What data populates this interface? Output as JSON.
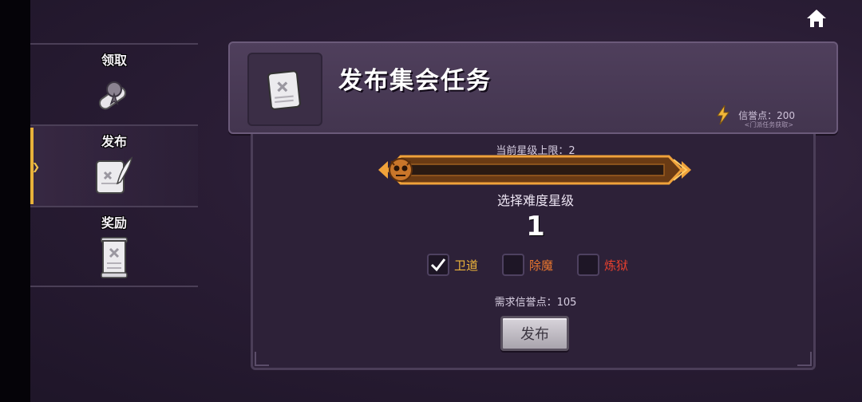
{
  "sidebar": {
    "items": [
      {
        "label": "领取",
        "icon": "scroll-sealed-icon",
        "active": false
      },
      {
        "label": "发布",
        "icon": "scroll-quill-icon",
        "active": true
      },
      {
        "label": "奖励",
        "icon": "scroll-open-icon",
        "active": false
      }
    ]
  },
  "header": {
    "title": "发布集会任务",
    "honor_label": "信誉点：200",
    "honor_sub": "<门派任务获取>"
  },
  "main": {
    "level_cap_text": "当前星级上限：2",
    "difficulty_label": "选择难度星级",
    "difficulty_value": "1",
    "options": [
      {
        "label": "卫道",
        "checked": true,
        "color": "#f0b63a"
      },
      {
        "label": "除魔",
        "checked": false,
        "color": "#e8762e"
      },
      {
        "label": "炼狱",
        "checked": false,
        "color": "#e8402e"
      }
    ],
    "required_text": "需求信誉点：105",
    "publish_button": "发布"
  },
  "colors": {
    "accent_gold": "#f0b63a",
    "panel": "#43354f",
    "background": "#2a1d35"
  }
}
